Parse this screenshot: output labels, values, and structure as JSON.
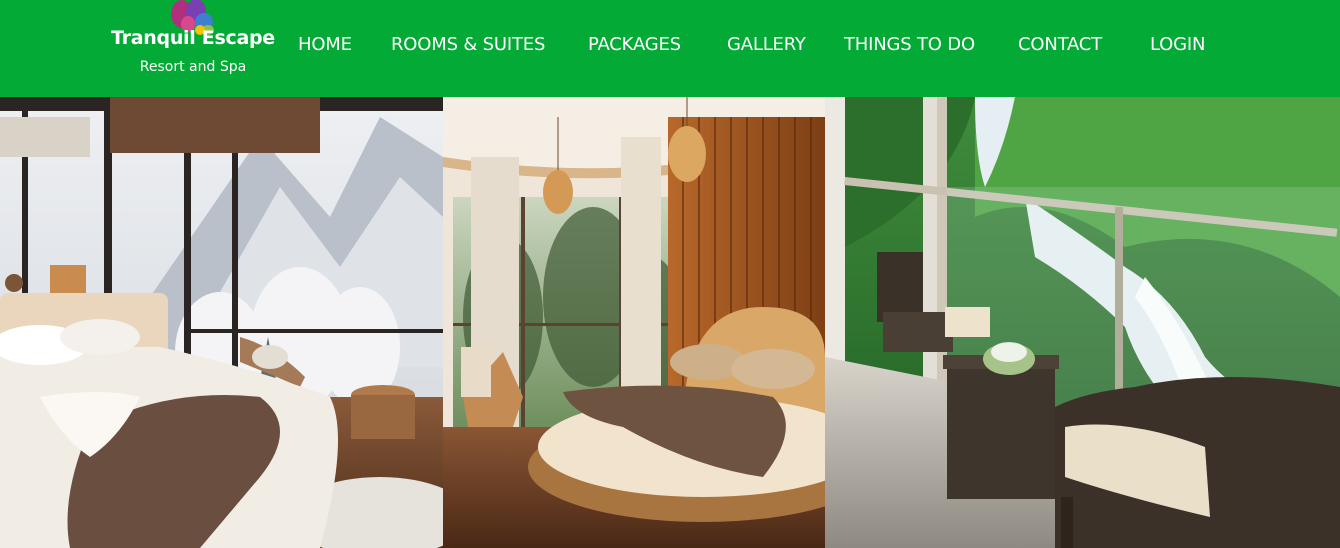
{
  "brand": {
    "name": "Tranquil Escape",
    "tagline": "Resort and Spa",
    "logo_icon": "butterfly-logo-icon"
  },
  "nav": {
    "items": [
      {
        "label": "HOME"
      },
      {
        "label": "ROOMS & SUITES"
      },
      {
        "label": "PACKAGES"
      },
      {
        "label": "GALLERY"
      },
      {
        "label": "THINGS TO DO"
      },
      {
        "label": "CONTACT"
      },
      {
        "label": "LOGIN"
      }
    ]
  },
  "colors": {
    "header_bg": "#03aa36",
    "nav_text": "#ffffff"
  },
  "gallery": {
    "images": [
      {
        "subject": "snowy-mountain-bedroom"
      },
      {
        "subject": "wooden-round-bedroom"
      },
      {
        "subject": "waterfall-view-balcony"
      }
    ]
  }
}
